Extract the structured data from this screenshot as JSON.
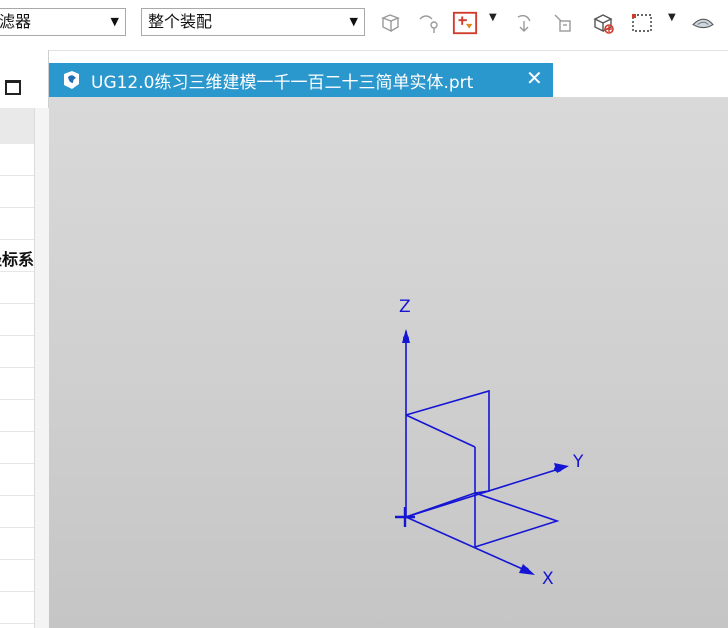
{
  "toolbar": {
    "filter_combo_value": "滤器",
    "assembly_combo_value": "整个装配",
    "icons": [
      "snap-view-icon",
      "point-snap-icon",
      "selection-filter-icon",
      "move-icon",
      "measure-icon",
      "cube-icon",
      "box-select-icon",
      "shade-icon"
    ]
  },
  "left_panel": {
    "visible_label": "坐标系",
    "maximize_icon": "maximize-icon"
  },
  "tab": {
    "title": "UG12.0练习三维建模一千一百二十三简单实体.prt",
    "close_glyph": "✕"
  },
  "viewport": {
    "axis_x": "X",
    "axis_y": "Y",
    "axis_z": "Z"
  },
  "colors": {
    "tab_blue": "#2a97cd",
    "model_blue": "#1515d4",
    "viewport_gray": "#cfcfcf"
  }
}
